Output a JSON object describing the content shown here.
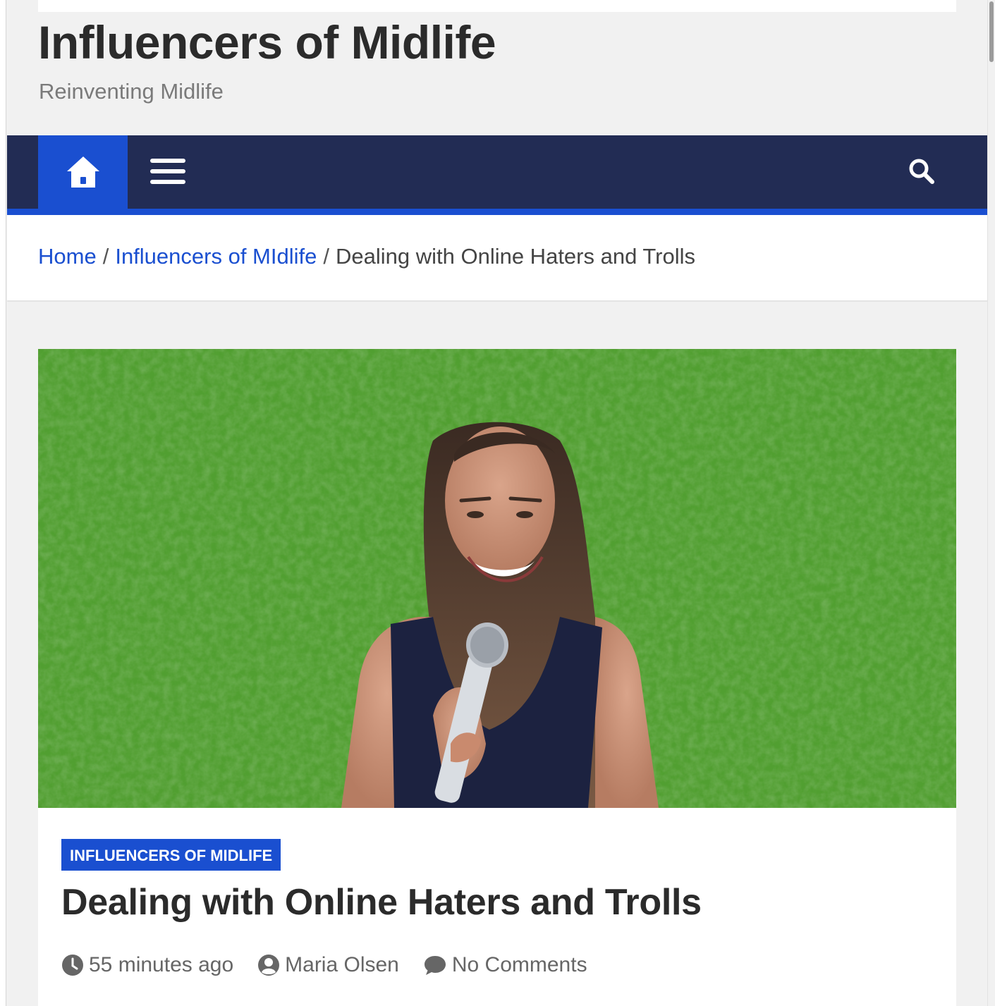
{
  "site": {
    "title": "Influencers of Midlife",
    "tagline": "Reinventing Midlife"
  },
  "navbar": {
    "home_icon": "home-icon",
    "menu_icon": "hamburger-menu-icon",
    "search_icon": "search-icon",
    "colors": {
      "bar": "#222c54",
      "accent": "#1a4fd0"
    }
  },
  "breadcrumb": {
    "items": [
      {
        "label": "Home",
        "link": true
      },
      {
        "label": "Influencers of MIdlife",
        "link": true
      },
      {
        "label": "Dealing with Online Haters and Trolls",
        "link": false
      }
    ],
    "separator": "/"
  },
  "post": {
    "category": "INFLUENCERS OF MIDLIFE",
    "title": "Dealing with Online Haters and Trolls",
    "meta": {
      "time": "55 minutes ago",
      "author": "Maria Olsen",
      "comments": "No Comments"
    },
    "image_description": "hero-photo"
  }
}
